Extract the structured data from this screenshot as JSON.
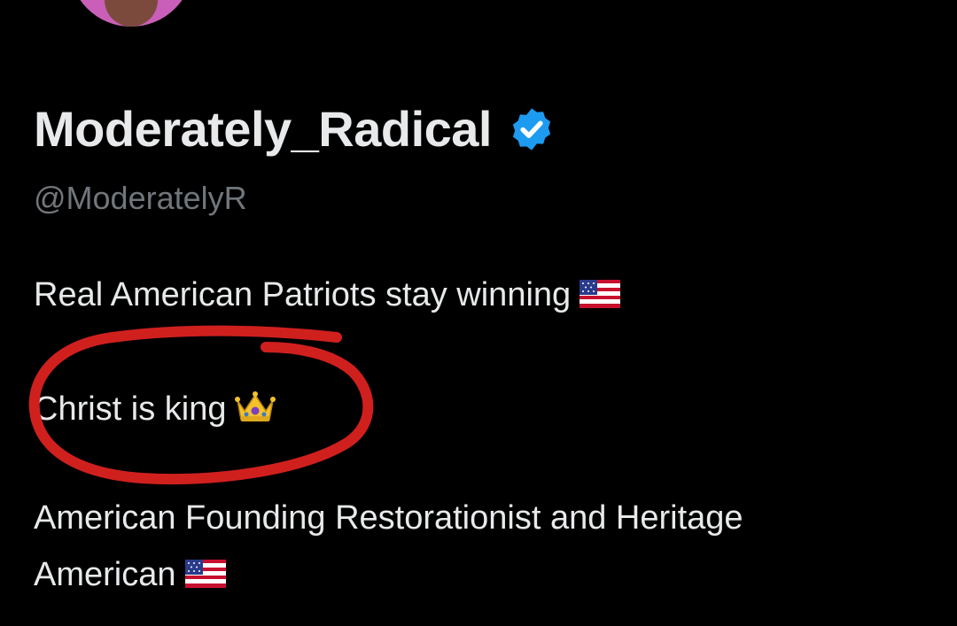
{
  "profile": {
    "display_name": "Moderately_Radical",
    "handle": "@ModeratelyR",
    "verified": true,
    "bio_lines": [
      "Real American Patriots stay winning",
      "Christ is king",
      "American Founding Restorationist and Heritage",
      "American"
    ],
    "bio_icons": [
      "us-flag-icon",
      "crown-icon",
      "us-flag-icon"
    ]
  },
  "colors": {
    "background": "#000000",
    "primary_text": "#e7e9ea",
    "secondary_text": "#71767b",
    "verified_badge": "#1d9bf0",
    "annotation": "#d0201e"
  }
}
